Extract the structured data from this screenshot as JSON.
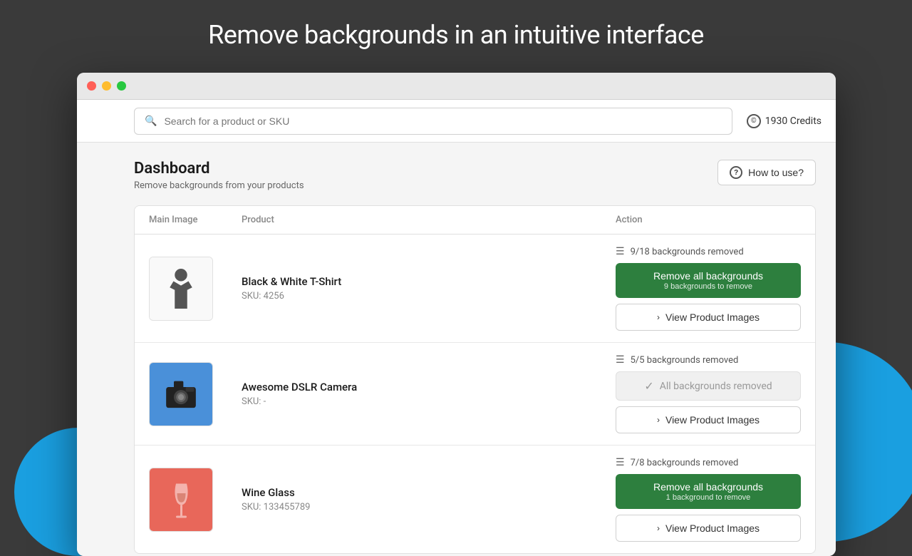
{
  "page": {
    "title": "Remove backgrounds in an intuitive interface",
    "background_color": "#3a3a3a"
  },
  "window": {
    "dots": [
      "red",
      "yellow",
      "green"
    ]
  },
  "header": {
    "search_placeholder": "Search for a product or SKU",
    "credits_label": "1930 Credits",
    "credits_icon": "©"
  },
  "dashboard": {
    "title": "Dashboard",
    "subtitle": "Remove backgrounds from your products",
    "how_to_label": "How to use?"
  },
  "table": {
    "columns": [
      "Main Image",
      "Product",
      "Action"
    ],
    "rows": [
      {
        "id": "tshirt",
        "product_name": "Black & White T-Shirt",
        "sku": "SKU: 4256",
        "bg_removed": "9/18 backgrounds removed",
        "action_primary": "Remove all backgrounds",
        "action_primary_sub": "9 backgrounds to remove",
        "action_state": "removable",
        "action_secondary": "View Product Images"
      },
      {
        "id": "camera",
        "product_name": "Awesome DSLR Camera",
        "sku": "SKU: -",
        "bg_removed": "5/5 backgrounds removed",
        "action_primary": "All backgrounds removed",
        "action_state": "all_removed",
        "action_secondary": "View Product Images"
      },
      {
        "id": "wineglass",
        "product_name": "Wine Glass",
        "sku": "SKU: 133455789",
        "bg_removed": "7/8 backgrounds removed",
        "action_primary": "Remove all backgrounds",
        "action_primary_sub": "1 background to remove",
        "action_state": "removable",
        "action_secondary": "View Product Images"
      }
    ]
  }
}
